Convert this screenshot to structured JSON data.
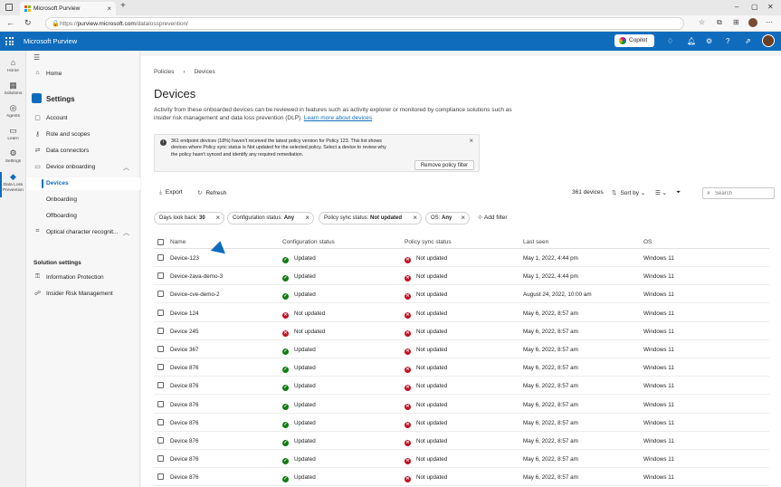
{
  "browser": {
    "tab_title": "Microsoft Purview",
    "url_host": "purview.microsoft.com",
    "url_path": "/datalossprevention/",
    "url_scheme": "https://"
  },
  "app": {
    "brand": "Microsoft Purview",
    "copilot_label": "Copilot"
  },
  "rail": [
    {
      "label": "Home",
      "icon": "home-icon",
      "glyph": "⌂"
    },
    {
      "label": "Solutions",
      "icon": "grid-icon",
      "glyph": "▦"
    },
    {
      "label": "Agents",
      "icon": "agents-icon",
      "glyph": "◎"
    },
    {
      "label": "Learn",
      "icon": "book-icon",
      "glyph": "▭"
    },
    {
      "label": "Settings",
      "icon": "gear-icon",
      "glyph": "⚙"
    },
    {
      "label": "Data Loss Prevention",
      "label_line1": "Data Loss",
      "label_line2": "Prevention",
      "icon": "shield-icon",
      "glyph": "◆"
    }
  ],
  "nav": {
    "home": "Home",
    "settings_title": "Settings",
    "items": [
      {
        "label": "Account",
        "icon": "account-icon",
        "glyph": "▢"
      },
      {
        "label": "Role and scopes",
        "icon": "key-icon",
        "glyph": "⚷"
      },
      {
        "label": "Data connectors",
        "icon": "connector-icon",
        "glyph": "⇄"
      },
      {
        "label": "Device onboarding",
        "icon": "device-icon",
        "glyph": "▭"
      }
    ],
    "device_sub": [
      "Devices",
      "Onboarding",
      "Offboarding"
    ],
    "ocr": "Optical character recognit...",
    "solution_settings": "Solution settings",
    "solutions": [
      {
        "label": "Information Protection",
        "icon": "lock-icon",
        "glyph": "⚿"
      },
      {
        "label": "Insider Risk Management",
        "icon": "people-icon",
        "glyph": "☍"
      }
    ]
  },
  "page": {
    "breadcrumb_parent": "Policies",
    "breadcrumb_current": "Devices",
    "title": "Devices",
    "description": "Activity from these onboarded devices can be reviewed in features such as activity explorer or monitored by compliance solutions such as insider risk management and data loss prevention (DLP).",
    "learn_more": "Learn more about devices"
  },
  "notice": {
    "bold": "361 endpoint devices (18%) haven't received the latest policy version for Policy 123.",
    "text": " This list shows devices where Policy sync status is Not updated for the selected policy. Select a device to review why the policy hasn't synced and identify any required remediation.",
    "button": "Remove policy filter"
  },
  "toolbar": {
    "export": "Export",
    "refresh": "Refresh",
    "count": "361 devices",
    "sort": "Sort by",
    "search_placeholder": "Search"
  },
  "filters": [
    {
      "key": "Days look back:",
      "value": "30"
    },
    {
      "key": "Configuration status:",
      "value": "Any"
    },
    {
      "key": "Policy sync status:",
      "value": "Not updated"
    },
    {
      "key": "OS:",
      "value": "Any"
    }
  ],
  "add_filter": "Add filter",
  "table": {
    "columns": [
      "Name",
      "Configuration status",
      "Policy sync status",
      "Last seen",
      "OS"
    ],
    "rows": [
      {
        "name": "Device-123",
        "config": "Updated",
        "config_ok": true,
        "sync": "Not updated",
        "sync_ok": false,
        "last_seen": "May 1, 2022, 4:44 pm",
        "os": "Windows 11"
      },
      {
        "name": "Device-zava-demo-3",
        "config": "Updated",
        "config_ok": true,
        "sync": "Not updated",
        "sync_ok": false,
        "last_seen": "May 1, 2022, 4:44 pm",
        "os": "Windows 11"
      },
      {
        "name": "Device-cve-demo-2",
        "config": "Updated",
        "config_ok": true,
        "sync": "Not updated",
        "sync_ok": false,
        "last_seen": "August 24, 2022, 10:00 am",
        "os": "Windows 11"
      },
      {
        "name": "Device 124",
        "config": "Not updated",
        "config_ok": false,
        "sync": "Not updated",
        "sync_ok": false,
        "last_seen": "May 6, 2022, 8:57 am",
        "os": "Windows 11"
      },
      {
        "name": "Device 245",
        "config": "Not updated",
        "config_ok": false,
        "sync": "Not updated",
        "sync_ok": false,
        "last_seen": "May 6, 2022, 8:57 am",
        "os": "Windows 11"
      },
      {
        "name": "Device 367",
        "config": "Updated",
        "config_ok": true,
        "sync": "Not updated",
        "sync_ok": false,
        "last_seen": "May 6, 2022, 8:57 am",
        "os": "Windows 11"
      },
      {
        "name": "Device 876",
        "config": "Updated",
        "config_ok": true,
        "sync": "Not updated",
        "sync_ok": false,
        "last_seen": "May 6, 2022, 8:57 am",
        "os": "Windows 11"
      },
      {
        "name": "Device 876",
        "config": "Updated",
        "config_ok": true,
        "sync": "Not updated",
        "sync_ok": false,
        "last_seen": "May 6, 2022, 8:57 am",
        "os": "Windows 11"
      },
      {
        "name": "Device 876",
        "config": "Updated",
        "config_ok": true,
        "sync": "Not updated",
        "sync_ok": false,
        "last_seen": "May 6, 2022, 8:57 am",
        "os": "Windows 11"
      },
      {
        "name": "Device 876",
        "config": "Updated",
        "config_ok": true,
        "sync": "Not updated",
        "sync_ok": false,
        "last_seen": "May 6, 2022, 8:57 am",
        "os": "Windows 11"
      },
      {
        "name": "Device 876",
        "config": "Updated",
        "config_ok": true,
        "sync": "Not updated",
        "sync_ok": false,
        "last_seen": "May 6, 2022, 8:57 am",
        "os": "Windows 11"
      },
      {
        "name": "Device 876",
        "config": "Updated",
        "config_ok": true,
        "sync": "Not updated",
        "sync_ok": false,
        "last_seen": "May 6, 2022, 8:57 am",
        "os": "Windows 11"
      },
      {
        "name": "Device 876",
        "config": "Updated",
        "config_ok": true,
        "sync": "Not updated",
        "sync_ok": false,
        "last_seen": "May 6, 2022, 8:57 am",
        "os": "Windows 11"
      }
    ]
  },
  "colors": {
    "accent": "#0f6cbd",
    "success": "#107c10",
    "error": "#c50f1f"
  }
}
